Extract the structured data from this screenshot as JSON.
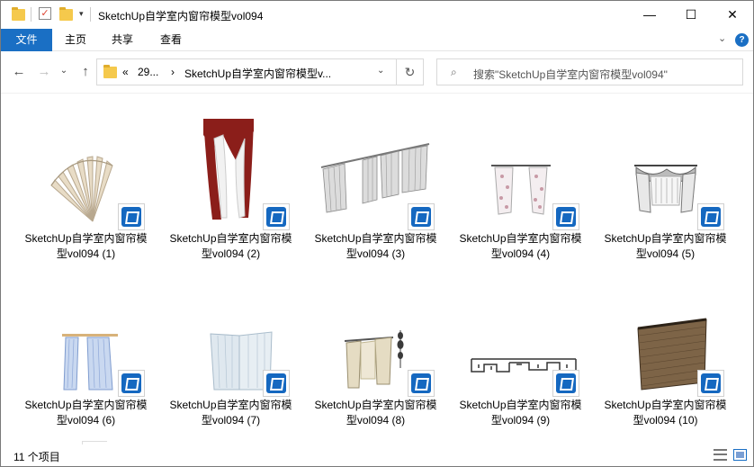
{
  "window": {
    "title": "SketchUp自学室内窗帘模型vol094",
    "minimize": "—",
    "maximize": "☐",
    "close": "✕"
  },
  "ribbon": {
    "tabs": [
      "文件",
      "主页",
      "共享",
      "查看"
    ],
    "collapse": "⌄",
    "help": "?"
  },
  "nav": {
    "back": "←",
    "forward": "→",
    "recent": "⌄",
    "up": "↑",
    "breadcrumb": [
      "«",
      "29...",
      "›",
      "SketchUp自学室内窗帘模型v..."
    ],
    "address_dropdown": "⌄",
    "refresh": "↻",
    "search_placeholder": "搜索\"SketchUp自学室内窗帘模型vol094\""
  },
  "files": [
    {
      "line1": "SketchUp自学室内窗帘模",
      "line2": "型vol094 (1)",
      "thumb": "pleated-fan"
    },
    {
      "line1": "SketchUp自学室内窗帘模",
      "line2": "型vol094 (2)",
      "thumb": "red-drape"
    },
    {
      "line1": "SketchUp自学室内窗帘模",
      "line2": "型vol094 (3)",
      "thumb": "grey-panels"
    },
    {
      "line1": "SketchUp自学室内窗帘模",
      "line2": "型vol094 (4)",
      "thumb": "floral-sheer"
    },
    {
      "line1": "SketchUp自学室内窗帘模",
      "line2": "型vol094 (5)",
      "thumb": "valance-lace"
    },
    {
      "line1": "SketchUp自学室内窗帘模",
      "line2": "型vol094 (6)",
      "thumb": "blue-sheer"
    },
    {
      "line1": "SketchUp自学室内窗帘模",
      "line2": "型vol094 (7)",
      "thumb": "pale-blue"
    },
    {
      "line1": "SketchUp自学室内窗帘模",
      "line2": "型vol094 (8)",
      "thumb": "beige-tassel"
    },
    {
      "line1": "SketchUp自学室内窗帘模",
      "line2": "型vol094 (9)",
      "thumb": "lattice-frame"
    },
    {
      "line1": "SketchUp自学室内窗帘模",
      "line2": "型vol094 (10)",
      "thumb": "bamboo-blind"
    }
  ],
  "status": {
    "count": "11 个项目"
  },
  "colors": {
    "accent": "#1a6fc4",
    "sketchup_badge": "#1568c0"
  }
}
